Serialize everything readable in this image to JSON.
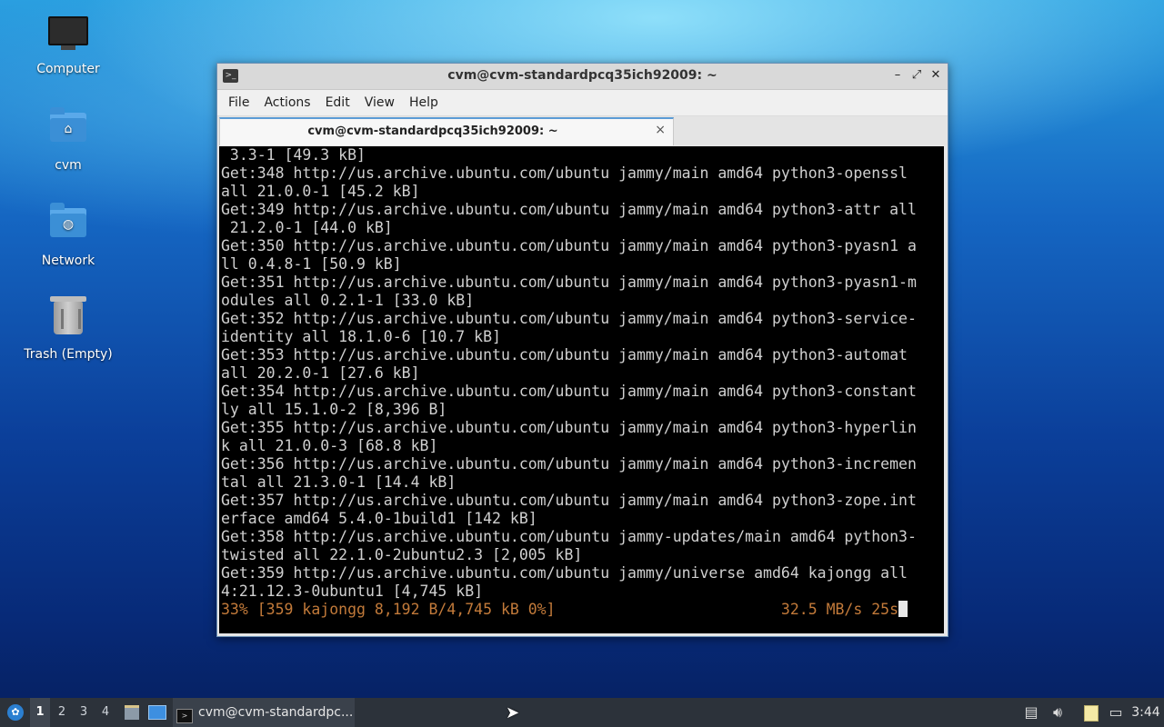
{
  "desktop": {
    "icons": [
      {
        "label": "Computer"
      },
      {
        "label": "cvm"
      },
      {
        "label": "Network"
      },
      {
        "label": "Trash (Empty)"
      }
    ]
  },
  "window": {
    "title": "cvm@cvm-standardpcq35ich92009: ~",
    "menu": [
      "File",
      "Actions",
      "Edit",
      "View",
      "Help"
    ],
    "tab_label": "cvm@cvm-standardpcq35ich92009: ~",
    "tab_close": "×",
    "controls": {
      "minimize": "–",
      "maximize": "⤢",
      "close": "✕"
    }
  },
  "terminal": {
    "lines": [
      " 3.3-1 [49.3 kB]",
      "Get:348 http://us.archive.ubuntu.com/ubuntu jammy/main amd64 python3-openssl",
      "all 21.0.0-1 [45.2 kB]",
      "Get:349 http://us.archive.ubuntu.com/ubuntu jammy/main amd64 python3-attr all",
      " 21.2.0-1 [44.0 kB]",
      "Get:350 http://us.archive.ubuntu.com/ubuntu jammy/main amd64 python3-pyasn1 a",
      "ll 0.4.8-1 [50.9 kB]",
      "Get:351 http://us.archive.ubuntu.com/ubuntu jammy/main amd64 python3-pyasn1-m",
      "odules all 0.2.1-1 [33.0 kB]",
      "Get:352 http://us.archive.ubuntu.com/ubuntu jammy/main amd64 python3-service-",
      "identity all 18.1.0-6 [10.7 kB]",
      "Get:353 http://us.archive.ubuntu.com/ubuntu jammy/main amd64 python3-automat",
      "all 20.2.0-1 [27.6 kB]",
      "Get:354 http://us.archive.ubuntu.com/ubuntu jammy/main amd64 python3-constant",
      "ly all 15.1.0-2 [8,396 B]",
      "Get:355 http://us.archive.ubuntu.com/ubuntu jammy/main amd64 python3-hyperlin",
      "k all 21.0.0-3 [68.8 kB]",
      "Get:356 http://us.archive.ubuntu.com/ubuntu jammy/main amd64 python3-incremen",
      "tal all 21.3.0-1 [14.4 kB]",
      "Get:357 http://us.archive.ubuntu.com/ubuntu jammy/main amd64 python3-zope.int",
      "erface amd64 5.4.0-1build1 [142 kB]",
      "Get:358 http://us.archive.ubuntu.com/ubuntu jammy-updates/main amd64 python3-",
      "twisted all 22.1.0-2ubuntu2.3 [2,005 kB]",
      "Get:359 http://us.archive.ubuntu.com/ubuntu jammy/universe amd64 kajongg all",
      "4:21.12.3-0ubuntu1 [4,745 kB]"
    ],
    "status_line": "33% [359 kajongg 8,192 B/4,745 kB 0%]                         32.5 MB/s 25s",
    "status_color": "#c27a3a"
  },
  "taskbar": {
    "workspaces": [
      "1",
      "2",
      "3",
      "4"
    ],
    "active_workspace": "1",
    "task_label": "cvm@cvm-standardpc...",
    "clock": "3:44"
  }
}
